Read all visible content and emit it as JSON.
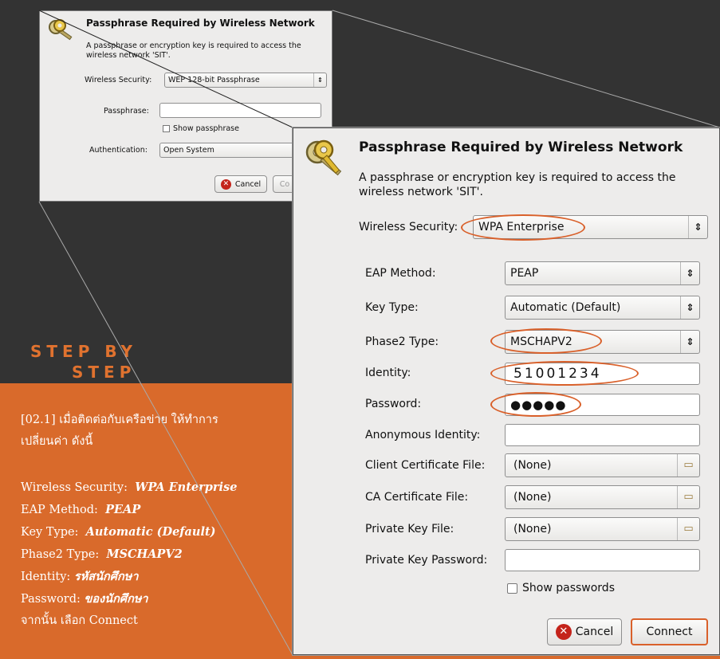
{
  "small_dialog": {
    "title": "Passphrase Required by Wireless Network",
    "description": "A passphrase or encryption key is required to access the wireless network 'SIT'.",
    "wireless_security_label": "Wireless Security:",
    "wireless_security_value": "WEP 128-bit Passphrase",
    "passphrase_label": "Passphrase:",
    "passphrase_value": "",
    "show_passphrase_label": "Show passphrase",
    "authentication_label": "Authentication:",
    "authentication_value": "Open System",
    "cancel_label": "Cancel",
    "connect_label": "Co"
  },
  "big_dialog": {
    "title": "Passphrase Required by Wireless Network",
    "description": "A passphrase or encryption key is required to access the wireless network 'SIT'.",
    "wireless_security_label": "Wireless Security:",
    "wireless_security_value": "WPA Enterprise",
    "eap_method_label": "EAP Method:",
    "eap_method_value": "PEAP",
    "key_type_label": "Key Type:",
    "key_type_value": "Automatic (Default)",
    "phase2_label": "Phase2 Type:",
    "phase2_value": "MSCHAPV2",
    "identity_label": "Identity:",
    "identity_value": "51001234",
    "password_label": "Password:",
    "password_value": "●●●●●",
    "anon_identity_label": "Anonymous Identity:",
    "anon_identity_value": "",
    "client_cert_label": "Client Certificate File:",
    "client_cert_value": "(None)",
    "ca_cert_label": "CA Certificate File:",
    "ca_cert_value": "(None)",
    "private_key_label": "Private Key File:",
    "private_key_value": "(None)",
    "private_key_password_label": "Private Key Password:",
    "private_key_password_value": "",
    "show_passwords_label": "Show passwords",
    "cancel_label": "Cancel",
    "connect_label": "Connect"
  },
  "slide": {
    "step_line1": "STEP BY",
    "step_line2": "STEP",
    "instruction_line1": "[02.1]  เมื่อติดต่อกับเครือข่าย ให้ทำการ",
    "instruction_line2": "เปลี่ยนค่า ดังนี้",
    "items": [
      {
        "label": "Wireless Security:",
        "value": "WPA Enterprise"
      },
      {
        "label": "EAP Method:",
        "value": "PEAP"
      },
      {
        "label": "Key Type:",
        "value": "Automatic (Default)"
      },
      {
        "label": "Phase2 Type:",
        "value": "MSCHAPV2"
      },
      {
        "label": "Identity:",
        "value": "รหัสนักศึกษา"
      },
      {
        "label": "Password:",
        "value": "ของนักศึกษา"
      }
    ],
    "final_line": "จากนั้น เลือก Connect"
  },
  "colors": {
    "background": "#333333",
    "accent": "#d96a2b",
    "highlight": "#d9602a"
  },
  "icons": [
    "keys-icon",
    "cancel-icon",
    "folder-icon"
  ]
}
